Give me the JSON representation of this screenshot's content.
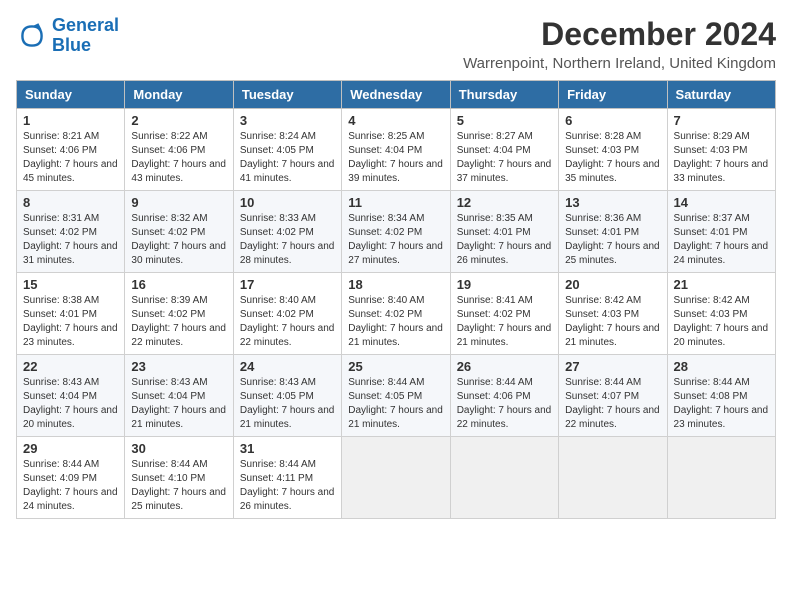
{
  "logo": {
    "line1": "General",
    "line2": "Blue"
  },
  "title": "December 2024",
  "subtitle": "Warrenpoint, Northern Ireland, United Kingdom",
  "days_of_week": [
    "Sunday",
    "Monday",
    "Tuesday",
    "Wednesday",
    "Thursday",
    "Friday",
    "Saturday"
  ],
  "weeks": [
    [
      {
        "day": "1",
        "sunrise": "8:21 AM",
        "sunset": "4:06 PM",
        "daylight": "7 hours and 45 minutes."
      },
      {
        "day": "2",
        "sunrise": "8:22 AM",
        "sunset": "4:06 PM",
        "daylight": "7 hours and 43 minutes."
      },
      {
        "day": "3",
        "sunrise": "8:24 AM",
        "sunset": "4:05 PM",
        "daylight": "7 hours and 41 minutes."
      },
      {
        "day": "4",
        "sunrise": "8:25 AM",
        "sunset": "4:04 PM",
        "daylight": "7 hours and 39 minutes."
      },
      {
        "day": "5",
        "sunrise": "8:27 AM",
        "sunset": "4:04 PM",
        "daylight": "7 hours and 37 minutes."
      },
      {
        "day": "6",
        "sunrise": "8:28 AM",
        "sunset": "4:03 PM",
        "daylight": "7 hours and 35 minutes."
      },
      {
        "day": "7",
        "sunrise": "8:29 AM",
        "sunset": "4:03 PM",
        "daylight": "7 hours and 33 minutes."
      }
    ],
    [
      {
        "day": "8",
        "sunrise": "8:31 AM",
        "sunset": "4:02 PM",
        "daylight": "7 hours and 31 minutes."
      },
      {
        "day": "9",
        "sunrise": "8:32 AM",
        "sunset": "4:02 PM",
        "daylight": "7 hours and 30 minutes."
      },
      {
        "day": "10",
        "sunrise": "8:33 AM",
        "sunset": "4:02 PM",
        "daylight": "7 hours and 28 minutes."
      },
      {
        "day": "11",
        "sunrise": "8:34 AM",
        "sunset": "4:02 PM",
        "daylight": "7 hours and 27 minutes."
      },
      {
        "day": "12",
        "sunrise": "8:35 AM",
        "sunset": "4:01 PM",
        "daylight": "7 hours and 26 minutes."
      },
      {
        "day": "13",
        "sunrise": "8:36 AM",
        "sunset": "4:01 PM",
        "daylight": "7 hours and 25 minutes."
      },
      {
        "day": "14",
        "sunrise": "8:37 AM",
        "sunset": "4:01 PM",
        "daylight": "7 hours and 24 minutes."
      }
    ],
    [
      {
        "day": "15",
        "sunrise": "8:38 AM",
        "sunset": "4:01 PM",
        "daylight": "7 hours and 23 minutes."
      },
      {
        "day": "16",
        "sunrise": "8:39 AM",
        "sunset": "4:02 PM",
        "daylight": "7 hours and 22 minutes."
      },
      {
        "day": "17",
        "sunrise": "8:40 AM",
        "sunset": "4:02 PM",
        "daylight": "7 hours and 22 minutes."
      },
      {
        "day": "18",
        "sunrise": "8:40 AM",
        "sunset": "4:02 PM",
        "daylight": "7 hours and 21 minutes."
      },
      {
        "day": "19",
        "sunrise": "8:41 AM",
        "sunset": "4:02 PM",
        "daylight": "7 hours and 21 minutes."
      },
      {
        "day": "20",
        "sunrise": "8:42 AM",
        "sunset": "4:03 PM",
        "daylight": "7 hours and 21 minutes."
      },
      {
        "day": "21",
        "sunrise": "8:42 AM",
        "sunset": "4:03 PM",
        "daylight": "7 hours and 20 minutes."
      }
    ],
    [
      {
        "day": "22",
        "sunrise": "8:43 AM",
        "sunset": "4:04 PM",
        "daylight": "7 hours and 20 minutes."
      },
      {
        "day": "23",
        "sunrise": "8:43 AM",
        "sunset": "4:04 PM",
        "daylight": "7 hours and 21 minutes."
      },
      {
        "day": "24",
        "sunrise": "8:43 AM",
        "sunset": "4:05 PM",
        "daylight": "7 hours and 21 minutes."
      },
      {
        "day": "25",
        "sunrise": "8:44 AM",
        "sunset": "4:05 PM",
        "daylight": "7 hours and 21 minutes."
      },
      {
        "day": "26",
        "sunrise": "8:44 AM",
        "sunset": "4:06 PM",
        "daylight": "7 hours and 22 minutes."
      },
      {
        "day": "27",
        "sunrise": "8:44 AM",
        "sunset": "4:07 PM",
        "daylight": "7 hours and 22 minutes."
      },
      {
        "day": "28",
        "sunrise": "8:44 AM",
        "sunset": "4:08 PM",
        "daylight": "7 hours and 23 minutes."
      }
    ],
    [
      {
        "day": "29",
        "sunrise": "8:44 AM",
        "sunset": "4:09 PM",
        "daylight": "7 hours and 24 minutes."
      },
      {
        "day": "30",
        "sunrise": "8:44 AM",
        "sunset": "4:10 PM",
        "daylight": "7 hours and 25 minutes."
      },
      {
        "day": "31",
        "sunrise": "8:44 AM",
        "sunset": "4:11 PM",
        "daylight": "7 hours and 26 minutes."
      },
      null,
      null,
      null,
      null
    ]
  ]
}
